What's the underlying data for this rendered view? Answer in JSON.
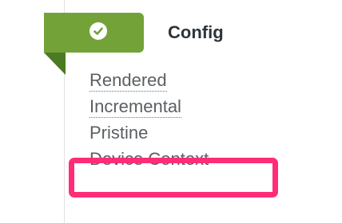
{
  "section": {
    "title": "Config",
    "status_icon": "check-circle-icon",
    "status_color": "#73a338"
  },
  "items": [
    {
      "label": "Rendered",
      "style": "dotted-underline"
    },
    {
      "label": "Incremental",
      "style": "dotted-underline"
    },
    {
      "label": "Pristine",
      "style": "plain"
    },
    {
      "label": "Device Context",
      "style": "plain"
    }
  ],
  "highlight": {
    "item": "Device Context",
    "color": "#ff2d78"
  }
}
